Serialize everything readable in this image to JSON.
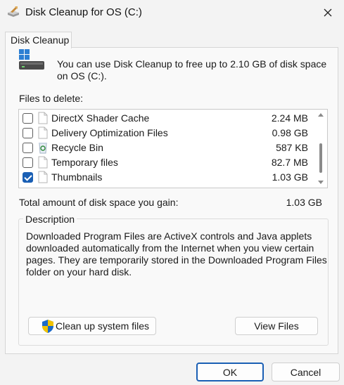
{
  "window": {
    "title": "Disk Cleanup for OS (C:)",
    "icons": {
      "app": "disk-cleanup-icon",
      "close": "close-icon"
    }
  },
  "tab": {
    "label": "Disk Cleanup"
  },
  "intro": {
    "text": "You can use Disk Cleanup to free up to 2.10 GB of disk space on OS (C:).",
    "icon": "drive-icon"
  },
  "files_label": "Files to delete:",
  "files": [
    {
      "name": "DirectX Shader Cache",
      "size": "2.24 MB",
      "checked": false,
      "icon": "file-icon"
    },
    {
      "name": "Delivery Optimization Files",
      "size": "0.98 GB",
      "checked": false,
      "icon": "file-icon"
    },
    {
      "name": "Recycle Bin",
      "size": "587 KB",
      "checked": false,
      "icon": "recycle-bin-icon"
    },
    {
      "name": "Temporary files",
      "size": "82.7 MB",
      "checked": false,
      "icon": "file-icon"
    },
    {
      "name": "Thumbnails",
      "size": "1.03 GB",
      "checked": true,
      "icon": "file-icon"
    }
  ],
  "total": {
    "label": "Total amount of disk space you gain:",
    "value": "1.03 GB"
  },
  "description": {
    "legend": "Description",
    "text": "Downloaded Program Files are ActiveX controls and Java applets downloaded automatically from the Internet when you view certain pages. They are temporarily stored in the Downloaded Program Files folder on your hard disk."
  },
  "buttons": {
    "cleanup": "Clean up system files",
    "view": "View Files",
    "ok": "OK",
    "cancel": "Cancel"
  },
  "colors": {
    "accent": "#1a5fb4",
    "shield_blue": "#1b6ac9",
    "shield_yellow": "#f2c300"
  }
}
